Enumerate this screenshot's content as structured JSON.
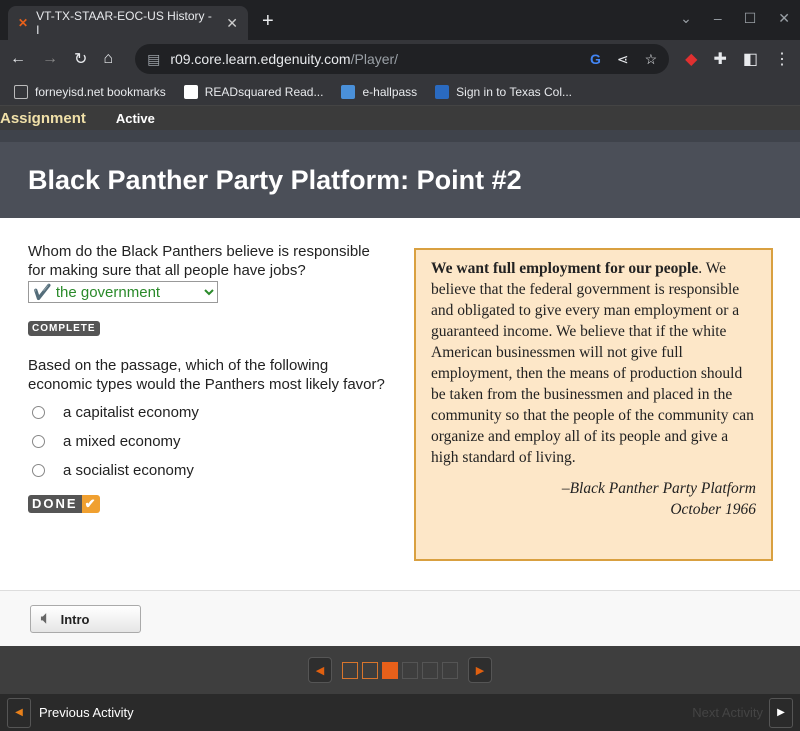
{
  "browser": {
    "tab_title": "VT-TX-STAAR-EOC-US History - I",
    "url_host": "r09.core.learn.edgenuity.com",
    "url_path": "/Player/",
    "bookmarks": [
      {
        "label": "forneyisd.net bookmarks",
        "icon": "folder-icon",
        "color": "#bbbbbb"
      },
      {
        "label": "READsquared Read...",
        "icon": "readsquared-icon",
        "color": "#ffffff"
      },
      {
        "label": "e-hallpass",
        "icon": "ehallpass-icon",
        "color": "#4a90d9"
      },
      {
        "label": "Sign in to Texas Col...",
        "icon": "texas-college-icon",
        "color": "#2a6ac0"
      }
    ]
  },
  "assignment": {
    "label": "Assignment",
    "status": "Active"
  },
  "page": {
    "title": "Black Panther Party Platform: Point #2"
  },
  "q1": {
    "text": "Whom do the Black Panthers believe is responsible for making sure that all people have jobs?",
    "selected": "✔️ the government",
    "badge": "COMPLETE"
  },
  "q2": {
    "text": "Based on the passage, which of the following economic types would the Panthers most likely favor?",
    "options": [
      "a capitalist economy",
      "a mixed economy",
      "a socialist economy"
    ],
    "done_label": "DONE"
  },
  "passage": {
    "bold": "We want full employment for our people",
    "body": ". We believe that the federal government is responsible and obligated to give every man employment or a guaranteed income. We believe that if the white American businessmen will not give full employment, then the means of production should be taken from the businessmen and placed in the community so that the people of the community can organize and employ all of its people and give a high standard of living.",
    "source": "–Black Panther Party Platform",
    "date": "October 1966"
  },
  "intro_label": "Intro",
  "pager": {
    "total": 6,
    "current": 3,
    "visited": [
      1,
      2
    ]
  },
  "footer": {
    "prev": "Previous Activity",
    "next": "Next Activity"
  },
  "colors": {
    "accent": "#e8601a",
    "header": "#4b4f58",
    "passage_bg": "#fde7c8"
  }
}
